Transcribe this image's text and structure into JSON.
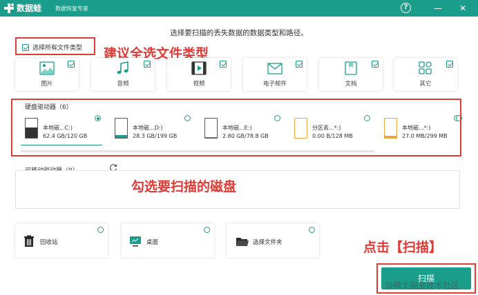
{
  "app": {
    "name": "数据蛙",
    "subtitle": "数据恢复专家",
    "help_icon": "question-icon",
    "minimize_label": "—",
    "close_label": "✕",
    "brand_color": "#1b9d8c"
  },
  "instruction": "选择要扫描的丢失数据的数据类型和路径。",
  "select_all_label": "选择所有文件类型",
  "file_types": [
    {
      "label": "图片",
      "icon": "image-icon",
      "checked": true
    },
    {
      "label": "音频",
      "icon": "music-icon",
      "checked": true
    },
    {
      "label": "视频",
      "icon": "video-icon",
      "checked": true
    },
    {
      "label": "电子邮件",
      "icon": "email-icon",
      "checked": true
    },
    {
      "label": "文档",
      "icon": "document-icon",
      "checked": true
    },
    {
      "label": "其它",
      "icon": "apps-icon",
      "checked": true
    }
  ],
  "hard_drives": {
    "title": "硬盘驱动器（6）",
    "drives": [
      {
        "name": "本地磁...C:)",
        "size": "62.4 GB/120 GB",
        "used": 0.52,
        "selected": true
      },
      {
        "name": "本地磁...D:)",
        "size": "28.3 GB/199 GB",
        "used": 0.14,
        "selected": false
      },
      {
        "name": "本地磁...E:)",
        "size": "2.80 GB/78.8 GB",
        "used": 0.04,
        "selected": false
      },
      {
        "name": "分区丢...*:)",
        "size": "0.00   B/128 MB",
        "used": 0.0,
        "selected": false
      },
      {
        "name": "本地磁...*:)",
        "size": "27.0 MB/299 MB",
        "used": 0.09,
        "selected": false
      }
    ]
  },
  "removable": {
    "title": "可移动驱动器（0）",
    "refresh_icon": "refresh-icon"
  },
  "locations": [
    {
      "label": "回收站",
      "icon": "trash-icon"
    },
    {
      "label": "桌面",
      "icon": "desktop-icon"
    },
    {
      "label": "选择文件夹",
      "icon": "folder-icon"
    }
  ],
  "scan_label": "扫描",
  "annotations": {
    "select_all_hint": "建议全选文件类型",
    "disk_hint": "勾选要扫描的磁盘",
    "scan_hint": "点击【扫描】",
    "color": "#e03a35"
  },
  "watermark": "@稀土掘金技术社区"
}
